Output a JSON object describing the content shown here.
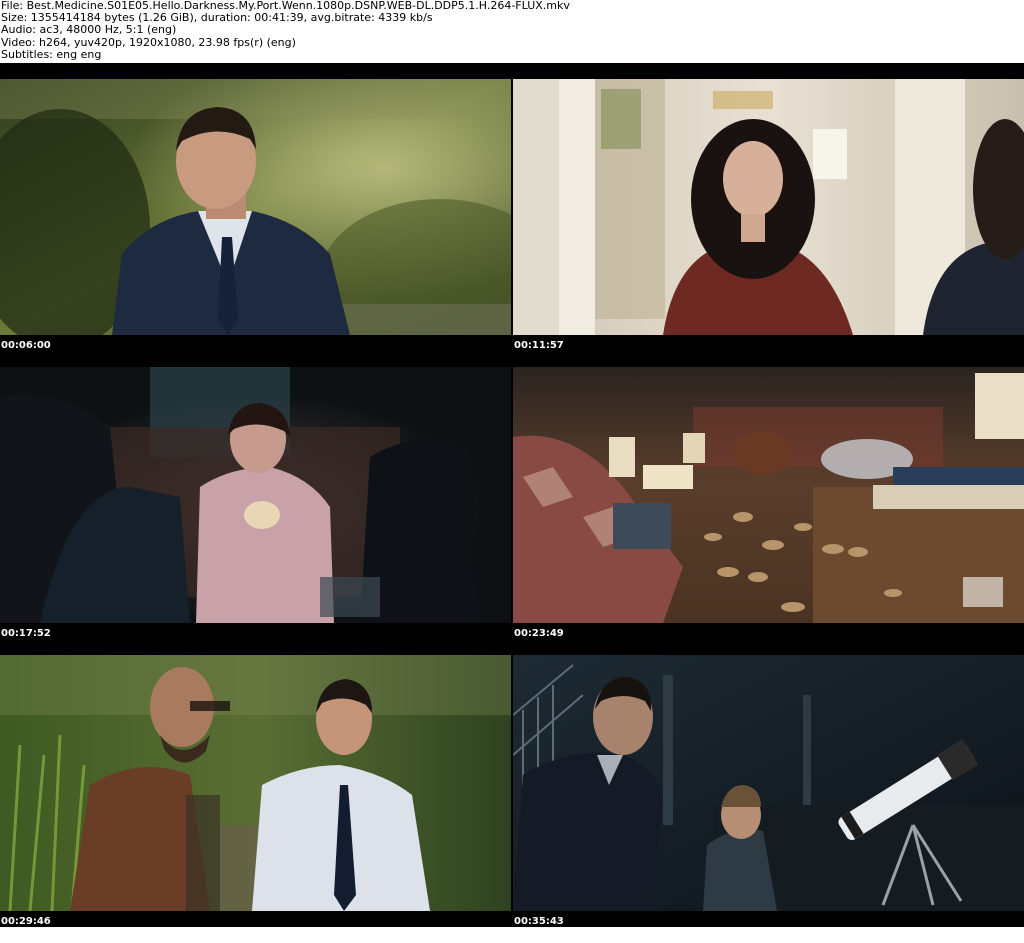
{
  "header": {
    "file_line": "File: Best.Medicine.S01E05.Hello.Darkness.My.Port.Wenn.1080p.DSNP.WEB-DL.DDP5.1.H.264-FLUX.mkv",
    "size_line": "Size: 1355414184 bytes (1.26 GiB), duration: 00:41:39, avg.bitrate: 4339 kb/s",
    "audio_line": "Audio: ac3, 48000 Hz, 5:1 (eng)",
    "video_line": "Video: h264, yuv420p, 1920x1080, 23.98 fps(r) (eng)",
    "subtitles_line": "Subtitles: eng eng"
  },
  "thumbnails": [
    {
      "timestamp": "00:06:00"
    },
    {
      "timestamp": "00:11:57"
    },
    {
      "timestamp": "00:17:52"
    },
    {
      "timestamp": "00:23:49"
    },
    {
      "timestamp": "00:29:46"
    },
    {
      "timestamp": "00:35:43"
    }
  ],
  "colors": {
    "sheet_background": "#000000",
    "header_background": "#ffffff",
    "timestamp_text": "#ffffff"
  }
}
